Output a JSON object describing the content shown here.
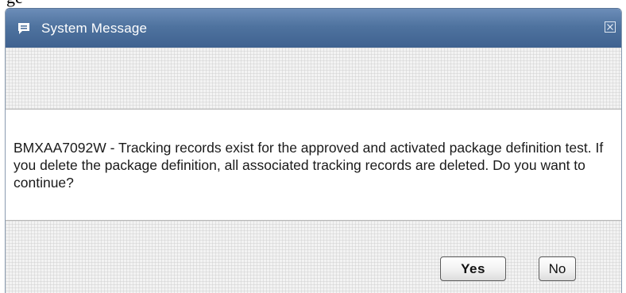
{
  "caption": "ge",
  "dialog": {
    "title": "System Message",
    "title_icon": "speech-bubble-icon",
    "close_icon": "close-box-icon",
    "message": "BMXAA7092W - Tracking records exist for the approved and activated package definition test. If you delete the package definition, all associated tracking records are deleted. Do you want to continue?",
    "buttons": {
      "yes_label": "Yes",
      "no_label": "No"
    }
  },
  "colors": {
    "titlebar": "#4f739f",
    "title_text": "#ffffff",
    "band_background": "#f3f3f3"
  }
}
